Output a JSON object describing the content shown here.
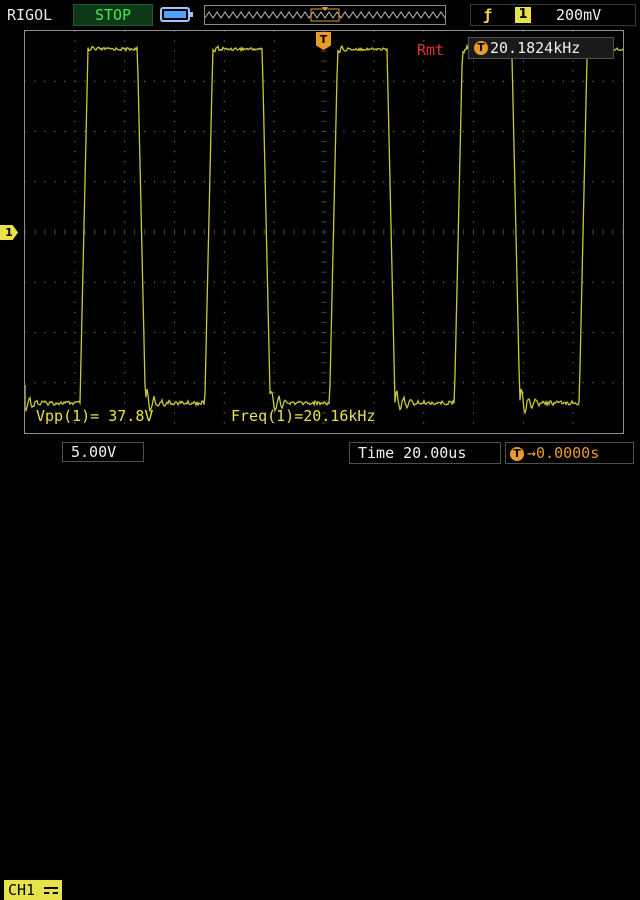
{
  "header": {
    "brand": "RIGOL",
    "run_state": "STOP",
    "trigger_edge_symbol": "ƒ",
    "trigger_source": "1",
    "trigger_level": "200mV"
  },
  "screen": {
    "remote_label": "Rmt",
    "counter_icon": "T",
    "counter_value": "20.1824kHz",
    "channel_marker": "1",
    "trigger_position_marker": "T",
    "measurements": [
      {
        "label": "Vpp(1)= 37.8V"
      },
      {
        "label": "Freq(1)=20.16kHz"
      }
    ]
  },
  "footer": {
    "channel_label": "CH1",
    "volts_per_div": "5.00V",
    "timebase": "Time 20.00us",
    "delay_icon": "T",
    "delay_value": "→0.0000s"
  },
  "icons": {
    "battery": "battery-icon",
    "memory": "memory-depth-icon",
    "trigger_edge": "rising-edge-icon",
    "coupling": "dc-coupling-icon"
  },
  "colors": {
    "trace": "#c8c83a",
    "grid": "#7a7a7a",
    "stop_text": "#48e848",
    "channel_yellow": "#e8e24a",
    "trigger_orange": "#e89a2a",
    "remote_red": "#e03030"
  }
}
